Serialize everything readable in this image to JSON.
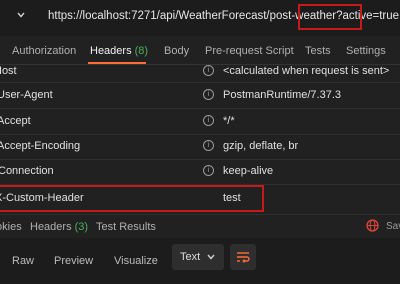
{
  "request": {
    "url": "https://localhost:7271/api/WeatherForecast/post-weather?active=true"
  },
  "tabs": [
    {
      "label": "Authorization",
      "count": ""
    },
    {
      "label": "Headers",
      "count": "(8)"
    },
    {
      "label": "Body",
      "count": ""
    },
    {
      "label": "Pre-request Script",
      "count": ""
    },
    {
      "label": "Tests",
      "count": ""
    },
    {
      "label": "Settings",
      "count": ""
    }
  ],
  "headers": [
    {
      "key": "Host",
      "value": "<calculated when request is sent>"
    },
    {
      "key": "User-Agent",
      "value": "PostmanRuntime/7.37.3"
    },
    {
      "key": "Accept",
      "value": "*/*"
    },
    {
      "key": "Accept-Encoding",
      "value": "gzip, deflate, br"
    },
    {
      "key": "Connection",
      "value": "keep-alive"
    },
    {
      "key": "X-Custom-Header",
      "value": "test"
    }
  ],
  "response_tabs": [
    {
      "label": "Cookies",
      "count": ""
    },
    {
      "label": "Headers",
      "count": "(3)"
    },
    {
      "label": "Test Results",
      "count": ""
    }
  ],
  "response_side_label": "Save",
  "format": {
    "buttons": [
      "Raw",
      "Preview",
      "Visualize"
    ],
    "selected": "Text"
  },
  "colors": {
    "accent": "#ff6c37",
    "highlight": "#c41a1a",
    "count": "#49b05a",
    "background": "#212121"
  },
  "icons": [
    "chevron-down-icon",
    "info-icon",
    "globe-icon",
    "wrap-lines-icon"
  ]
}
